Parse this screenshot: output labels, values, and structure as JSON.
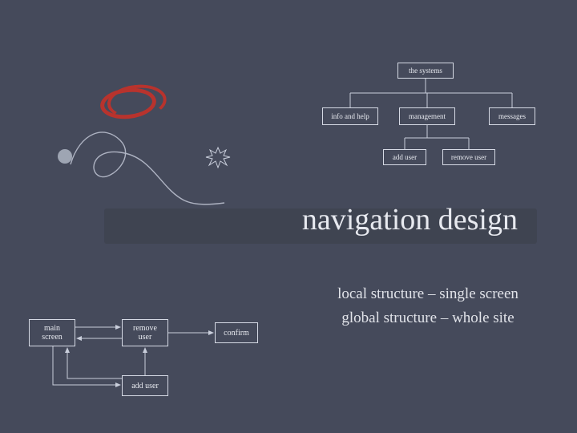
{
  "title": "navigation design",
  "tree": {
    "root": "the systems",
    "info": "info and help",
    "management": "management",
    "messages": "messages",
    "add_user": "add user",
    "remove_user": "remove user"
  },
  "subtitles": {
    "local": "local structure – single screen",
    "global": "global structure – whole site"
  },
  "flow": {
    "main": "main screen",
    "remove": "remove user",
    "confirm": "confirm",
    "add_user": "add user"
  }
}
